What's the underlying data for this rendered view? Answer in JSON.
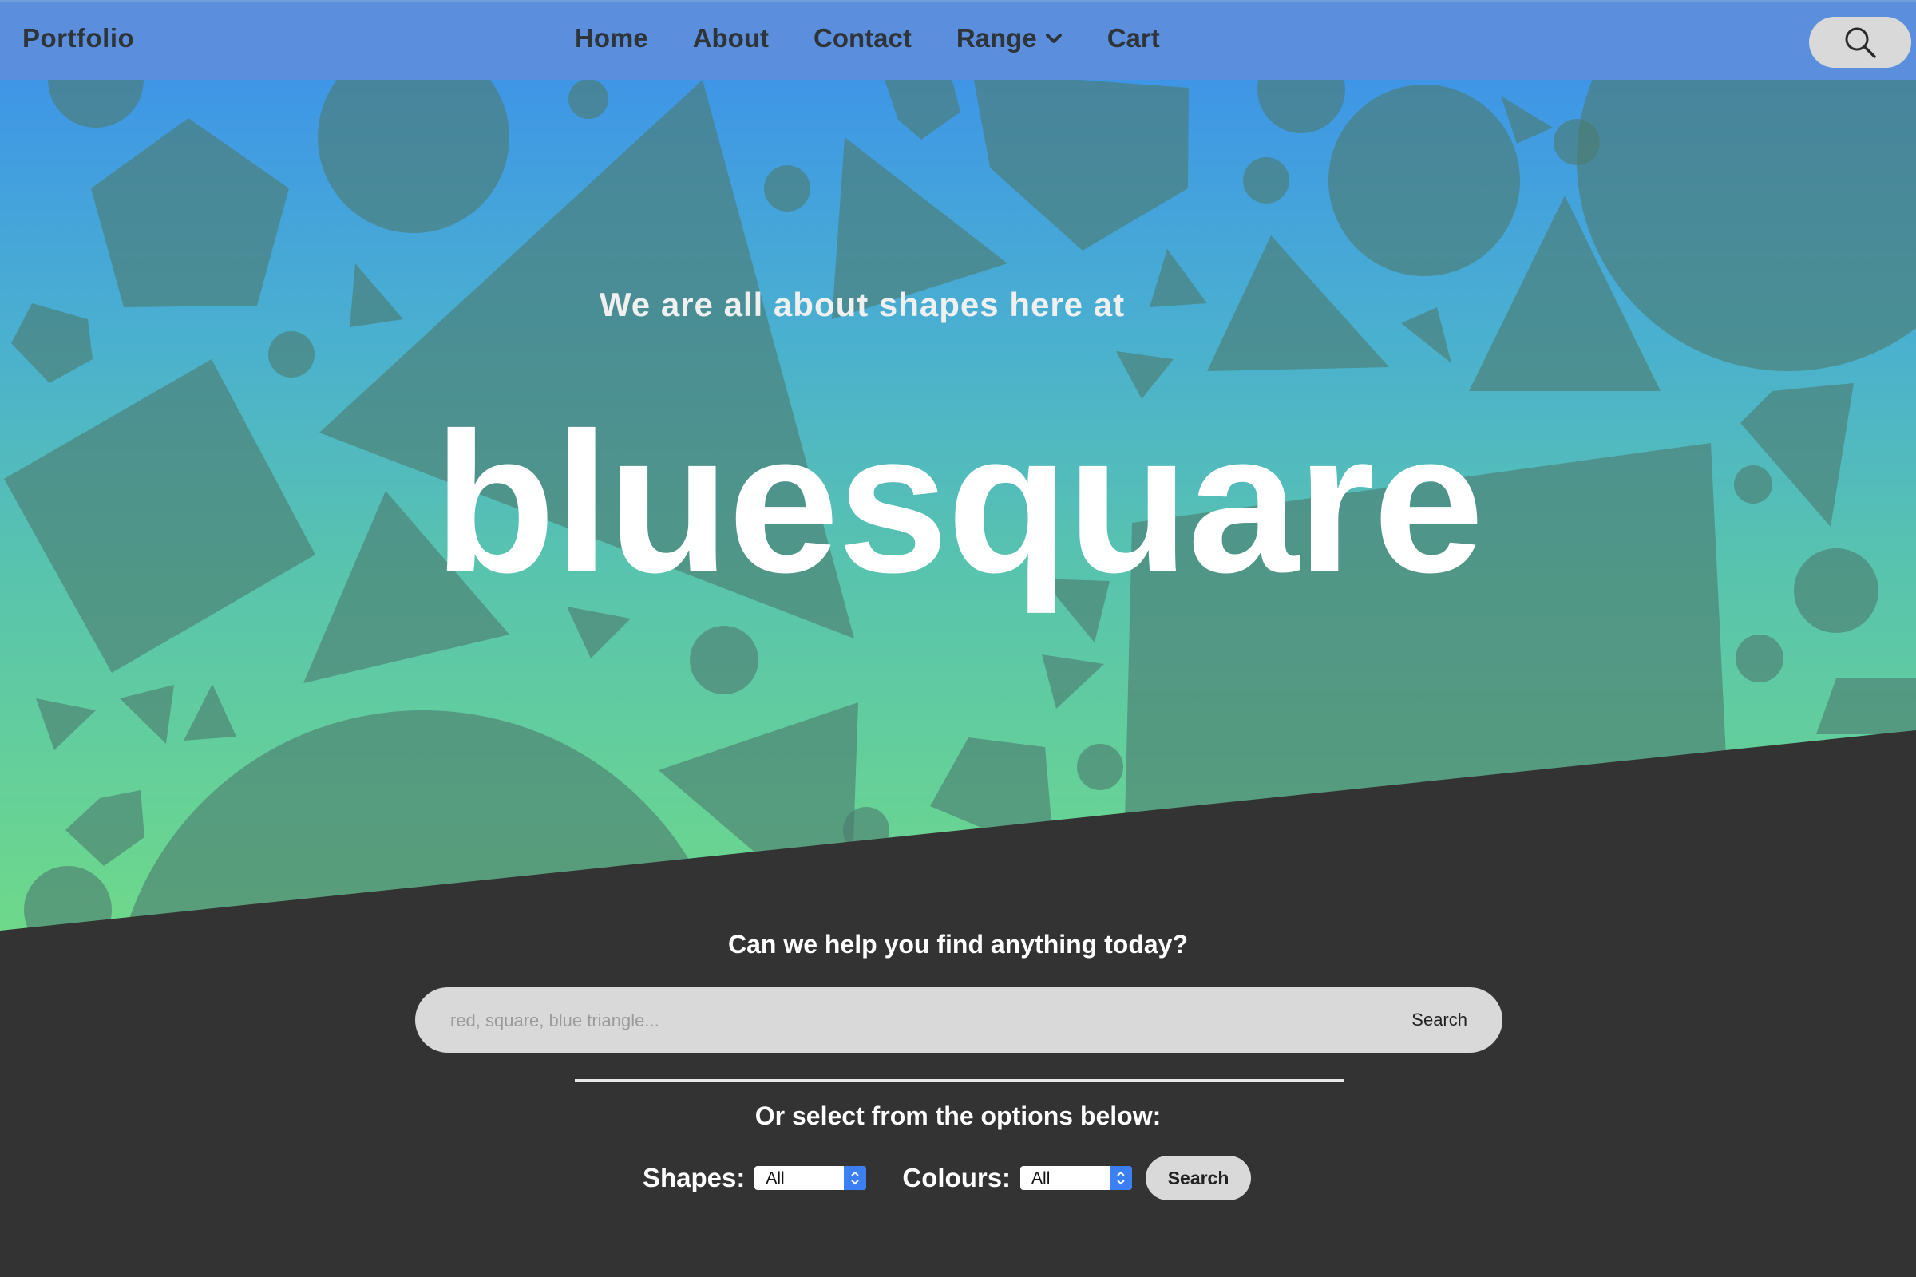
{
  "nav": {
    "brand": "Portfolio",
    "links": [
      "Home",
      "About",
      "Contact",
      "Range",
      "Cart"
    ],
    "range_has_dropdown": true,
    "search_icon": "magnifier-icon"
  },
  "hero": {
    "subtitle": "We are all about shapes here at",
    "title": "bluesquare"
  },
  "search": {
    "heading": "Can we help you find anything today?",
    "placeholder": "red, square, blue triangle...",
    "value": "",
    "button": "Search"
  },
  "options": {
    "heading": "Or select from the options below:",
    "shapes_label": "Shapes:",
    "shapes_value": "All",
    "colours_label": "Colours:",
    "colours_value": "All",
    "button": "Search"
  },
  "colors": {
    "nav_bg": "#5b8fdd",
    "dark_bg": "#333333",
    "gradient_top": "#3f96e6",
    "gradient_bottom": "#6ed98a",
    "shape_fill": "#4c7a6f"
  }
}
